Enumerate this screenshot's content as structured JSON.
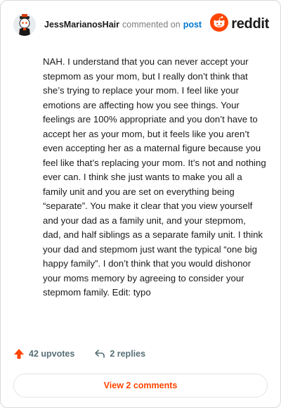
{
  "header": {
    "username": "JessMarianosHair",
    "action_text": "commented on",
    "post_link": "post",
    "brand_name": "reddit",
    "avatar_icon": "snoo-avatar-icon",
    "brand_icon": "reddit-logo-icon"
  },
  "comment": {
    "body": "NAH. I understand that you can never accept your stepmom as your mom, but I really don’t think that she’s trying to replace your mom. I feel like your emotions are affecting how you see things. Your feelings are 100% appropriate and you don’t have to accept her as your mom, but it feels like you aren’t even accepting her as a maternal figure because you feel like that’s replacing your mom. It’s not and nothing ever can. I think she just wants to make you all a family unit and you are set on everything being “separate”. You make it clear that you view yourself and your dad as a family unit, and your stepmom, dad, and half siblings as a separate family unit. I think your dad and stepmom just want the typical “one big happy family”. I don’t think that you would dishonor your moms memory by agreeing to consider your stepmom family. Edit: typo"
  },
  "footer": {
    "upvotes": "42 upvotes",
    "replies": "2 replies",
    "upvote_icon": "upvote-arrow-icon",
    "reply_icon": "reply-arrow-icon"
  },
  "view_comments_label": "View 2 comments",
  "colors": {
    "accent": "#ff4500",
    "link": "#0079d3",
    "muted": "#576f76"
  }
}
